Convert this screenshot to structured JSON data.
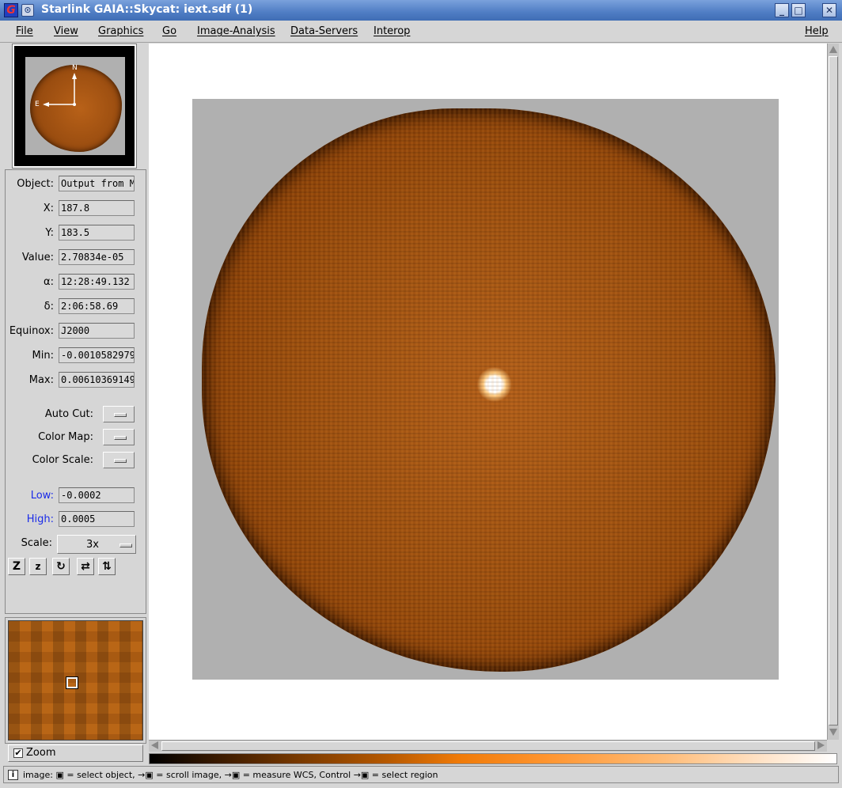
{
  "window": {
    "title": "Starlink GAIA::Skycat: iext.sdf (1)",
    "app_icon": "G",
    "buttons": [
      "minimize",
      "maximize",
      "close"
    ]
  },
  "menubar": {
    "items": [
      "File",
      "View",
      "Graphics",
      "Go",
      "Image-Analysis",
      "Data-Servers",
      "Interop"
    ],
    "help": "Help"
  },
  "panner": {
    "north_label": "N",
    "east_label": "E"
  },
  "info": {
    "object_label": "Object:",
    "object_value": "Output from M",
    "x_label": "X:",
    "x_value": "187.8",
    "y_label": "Y:",
    "y_value": "183.5",
    "value_label": "Value:",
    "value_value": "2.70834e-05",
    "alpha_label": "α:",
    "alpha_value": "12:28:49.132",
    "delta_label": "δ:",
    "delta_value": "2:06:58.69",
    "equinox_label": "Equinox:",
    "equinox_value": "J2000",
    "min_label": "Min:",
    "min_value": "-0.0010582979",
    "max_label": "Max:",
    "max_value": "0.00610369149"
  },
  "options": {
    "autocut_label": "Auto Cut:",
    "colormap_label": "Color Map:",
    "colorscale_label": "Color Scale:"
  },
  "cuts": {
    "low_label": "Low:",
    "low_value": "-0.0002",
    "high_label": "High:",
    "high_value": "0.0005"
  },
  "scale": {
    "label": "Scale:",
    "value": "3x"
  },
  "zoom": {
    "label": "Zoom",
    "checked": true
  },
  "status": {
    "text": "image: ▣ = select object, →▣ = scroll image, →▣ = measure WCS, Control →▣ = select region"
  },
  "colors": {
    "titlebar": "#4f7dc4",
    "image_orange": "#9c5010",
    "label_blue": "#1a2be8"
  }
}
